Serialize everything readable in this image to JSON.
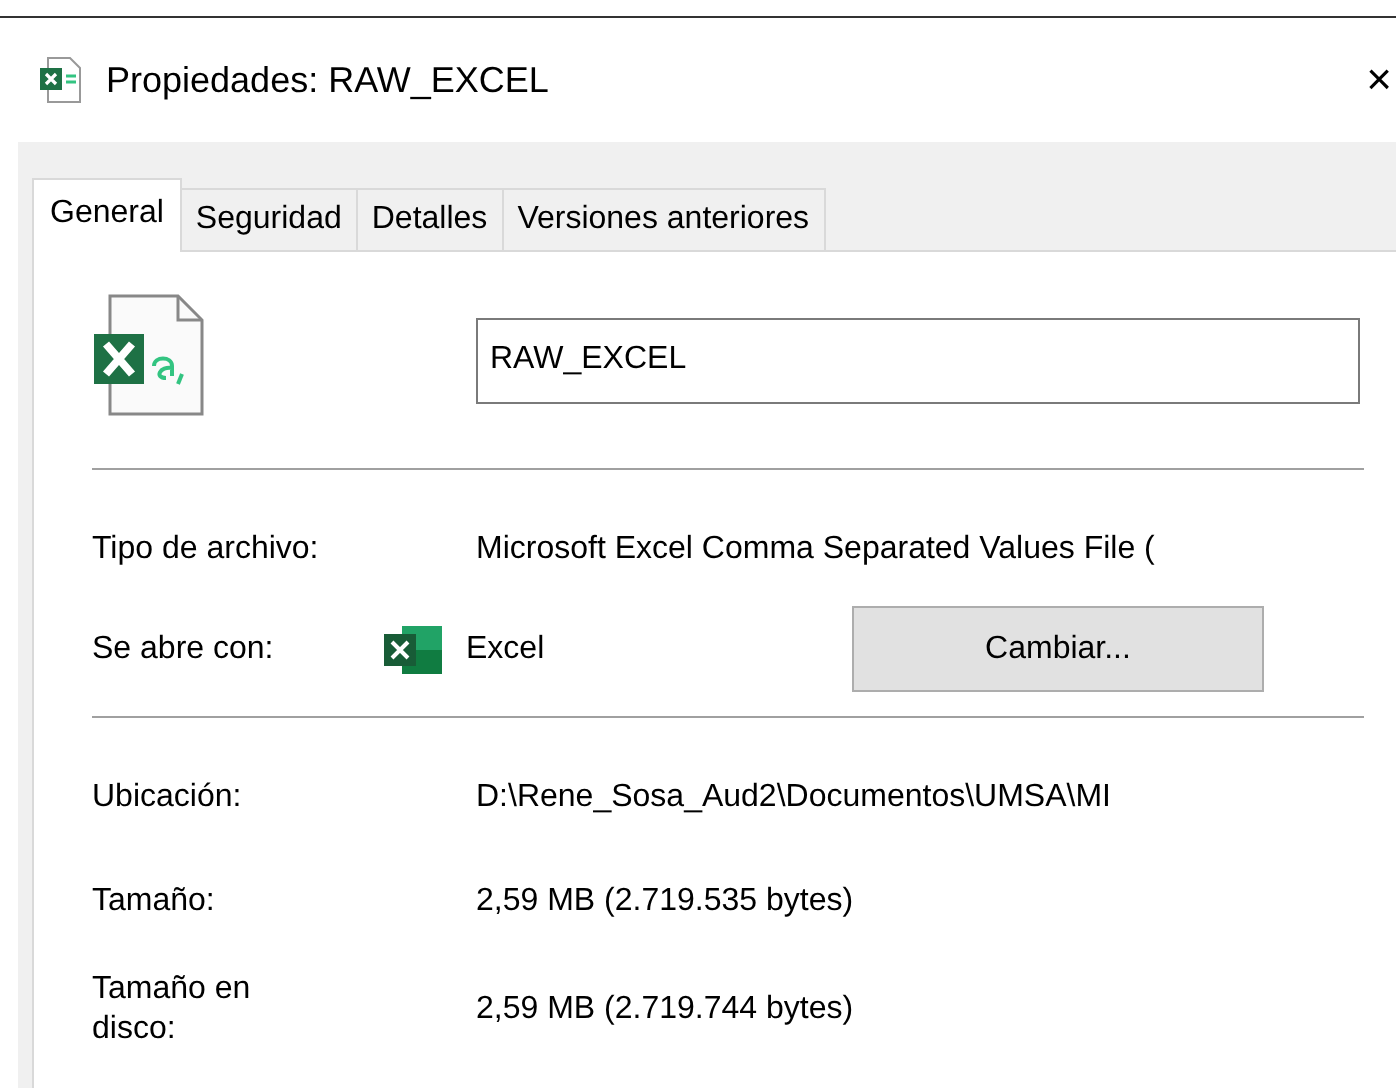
{
  "window": {
    "title": "Propiedades: RAW_EXCEL",
    "close": "×"
  },
  "tabs": [
    {
      "label": "General",
      "selected": true
    },
    {
      "label": "Seguridad",
      "selected": false
    },
    {
      "label": "Detalles",
      "selected": false
    },
    {
      "label": "Versiones anteriores",
      "selected": false
    }
  ],
  "file_name": {
    "value": "RAW_EXCEL"
  },
  "type_row": {
    "label": "Tipo de archivo:",
    "value": "Microsoft Excel Comma Separated Values File ("
  },
  "opens_with": {
    "label": "Se abre con:",
    "app": "Excel",
    "button": "Cambiar..."
  },
  "details": [
    {
      "label": "Ubicación:",
      "value": "D:\\Rene_Sosa_Aud2\\Documentos\\UMSA\\MI"
    },
    {
      "label": "Tamaño:",
      "value": "2,59 MB (2.719.535 bytes)"
    },
    {
      "label": "Tamaño en disco:",
      "value": "2,59 MB (2.719.744 bytes)"
    }
  ]
}
